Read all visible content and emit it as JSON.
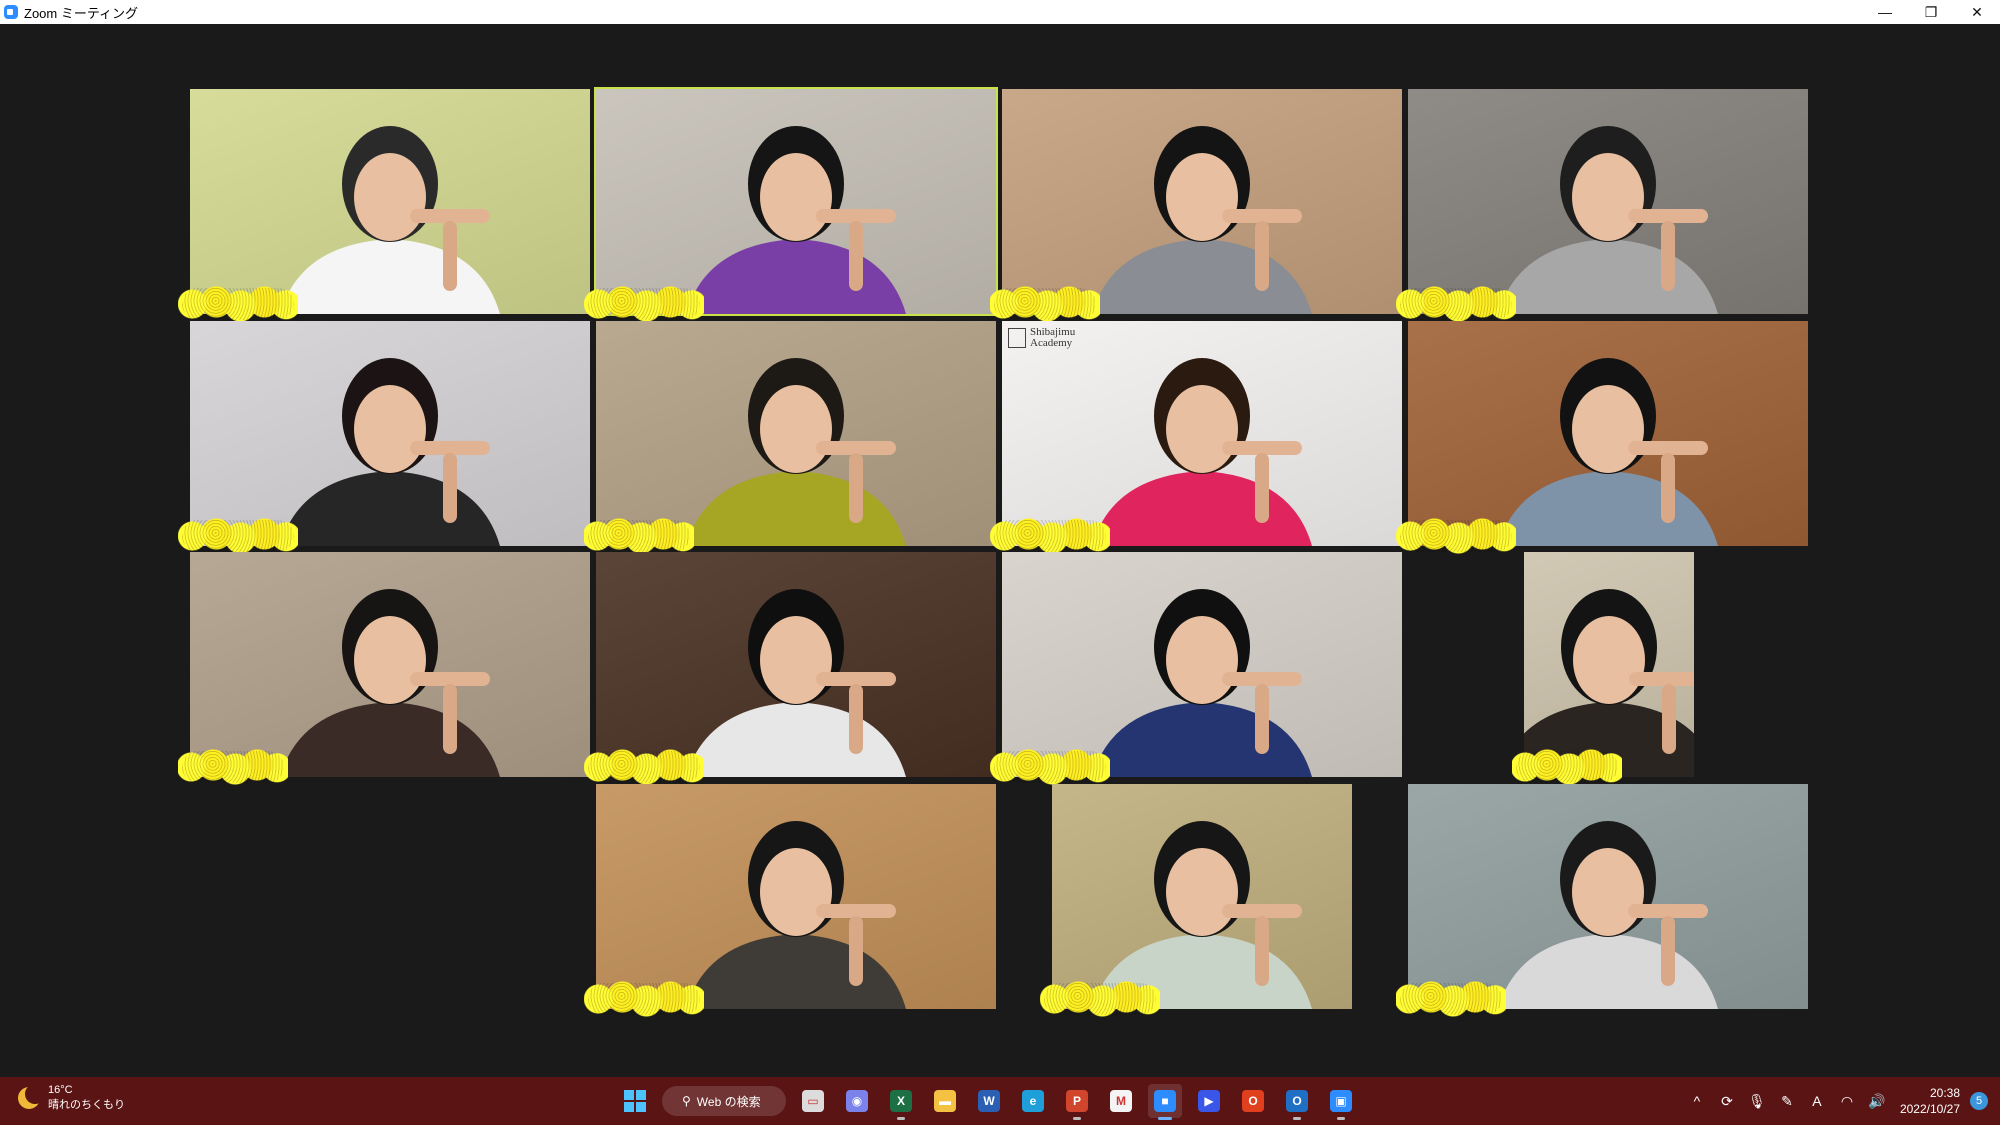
{
  "window": {
    "title": "Zoom ミーティング",
    "controls": {
      "minimize": "—",
      "restore": "❐",
      "close": "✕"
    }
  },
  "gallery": {
    "tiles": [
      {
        "id": 1,
        "row": 1,
        "col": 1,
        "active": false,
        "bg": "#d7dc9a",
        "shirt": "#f5f5f5",
        "hair": "#2a2a2a"
      },
      {
        "id": 2,
        "row": 1,
        "col": 2,
        "active": true,
        "bg": "#cbc6bd",
        "shirt": "#7a3fa6",
        "hair": "#151515"
      },
      {
        "id": 3,
        "row": 1,
        "col": 3,
        "active": false,
        "bg": "#c9a889",
        "shirt": "#8a8d93",
        "hair": "#141414"
      },
      {
        "id": 4,
        "row": 1,
        "col": 4,
        "active": false,
        "bg": "#8f8b86",
        "shirt": "#a7a7a7",
        "hair": "#1e1e1e"
      },
      {
        "id": 5,
        "row": 2,
        "col": 1,
        "active": false,
        "bg": "#d8d6d8",
        "shirt": "#262626",
        "hair": "#1c1414"
      },
      {
        "id": 6,
        "row": 2,
        "col": 2,
        "active": false,
        "bg": "#b9a991",
        "shirt": "#a7a624",
        "hair": "#1d1a16"
      },
      {
        "id": 7,
        "row": 2,
        "col": 3,
        "active": false,
        "bg": "#f4f2f1",
        "shirt": "#e0245e",
        "hair": "#2a1a10",
        "brand": "Shibajimu Academy"
      },
      {
        "id": 8,
        "row": 2,
        "col": 4,
        "active": false,
        "bg": "#a9714a",
        "shirt": "#7e93a8",
        "hair": "#121212"
      },
      {
        "id": 9,
        "row": 3,
        "col": 1,
        "active": false,
        "bg": "#b7a795",
        "shirt": "#3a2b27",
        "hair": "#171414"
      },
      {
        "id": 10,
        "row": 3,
        "col": 2,
        "active": false,
        "bg": "#5b4538",
        "shirt": "#e7e7e7",
        "hair": "#0f0f0f"
      },
      {
        "id": 11,
        "row": 3,
        "col": 3,
        "active": false,
        "bg": "#d9d4cd",
        "shirt": "#243572",
        "hair": "#101010"
      },
      {
        "id": 12,
        "row": 3,
        "col": 4,
        "active": false,
        "bg": "#d2c9b5",
        "shirt": "#2b2521",
        "hair": "#141414"
      },
      {
        "id": 13,
        "row": 4,
        "col": 2,
        "active": false,
        "bg": "#c79a67",
        "shirt": "#3f3b37",
        "hair": "#161616"
      },
      {
        "id": 14,
        "row": 4,
        "col": 3,
        "active": false,
        "bg": "#c5b689",
        "shirt": "#c7d4c7",
        "hair": "#161616"
      },
      {
        "id": 15,
        "row": 4,
        "col": 4,
        "active": false,
        "bg": "#9aa7a6",
        "shirt": "#d9d9d9",
        "hair": "#1a1a1a"
      }
    ]
  },
  "taskbar": {
    "weather": {
      "temp": "16°C",
      "desc": "晴れのちくもり",
      "icon": "moon-cloud-icon"
    },
    "search_label": "Web の検索",
    "apps": [
      {
        "name": "task-view-icon",
        "color": "#dcdcdc",
        "glyph": "▭",
        "running": false
      },
      {
        "name": "teams-chat-icon",
        "color": "#7b83eb",
        "glyph": "◉",
        "running": false
      },
      {
        "name": "excel-icon",
        "color": "#1d7044",
        "glyph": "X",
        "running": true
      },
      {
        "name": "file-explorer-icon",
        "color": "#f5c142",
        "glyph": "▬",
        "running": false
      },
      {
        "name": "word-icon",
        "color": "#2b5fb4",
        "glyph": "W",
        "running": false
      },
      {
        "name": "edge-icon",
        "color": "#1f9fd9",
        "glyph": "e",
        "running": false
      },
      {
        "name": "powerpoint-icon",
        "color": "#d0452b",
        "glyph": "P",
        "running": true
      },
      {
        "name": "gmail-icon",
        "color": "#f4f4f4",
        "glyph": "M",
        "running": false
      },
      {
        "name": "zoom-icon",
        "color": "#2d8cff",
        "glyph": "■",
        "running": true,
        "active": true
      },
      {
        "name": "zoom-share-icon",
        "color": "#3a56e8",
        "glyph": "▶",
        "running": false
      },
      {
        "name": "office-icon",
        "color": "#e1401f",
        "glyph": "O",
        "running": false
      },
      {
        "name": "outlook-icon",
        "color": "#1f6fc4",
        "glyph": "O",
        "running": true
      },
      {
        "name": "zoom-meetings-icon",
        "color": "#2d8cff",
        "glyph": "▣",
        "running": true
      }
    ],
    "tray": {
      "chevron": "^",
      "ime": "A",
      "time": "20:38",
      "date": "2022/10/27",
      "notifications": "5"
    }
  }
}
